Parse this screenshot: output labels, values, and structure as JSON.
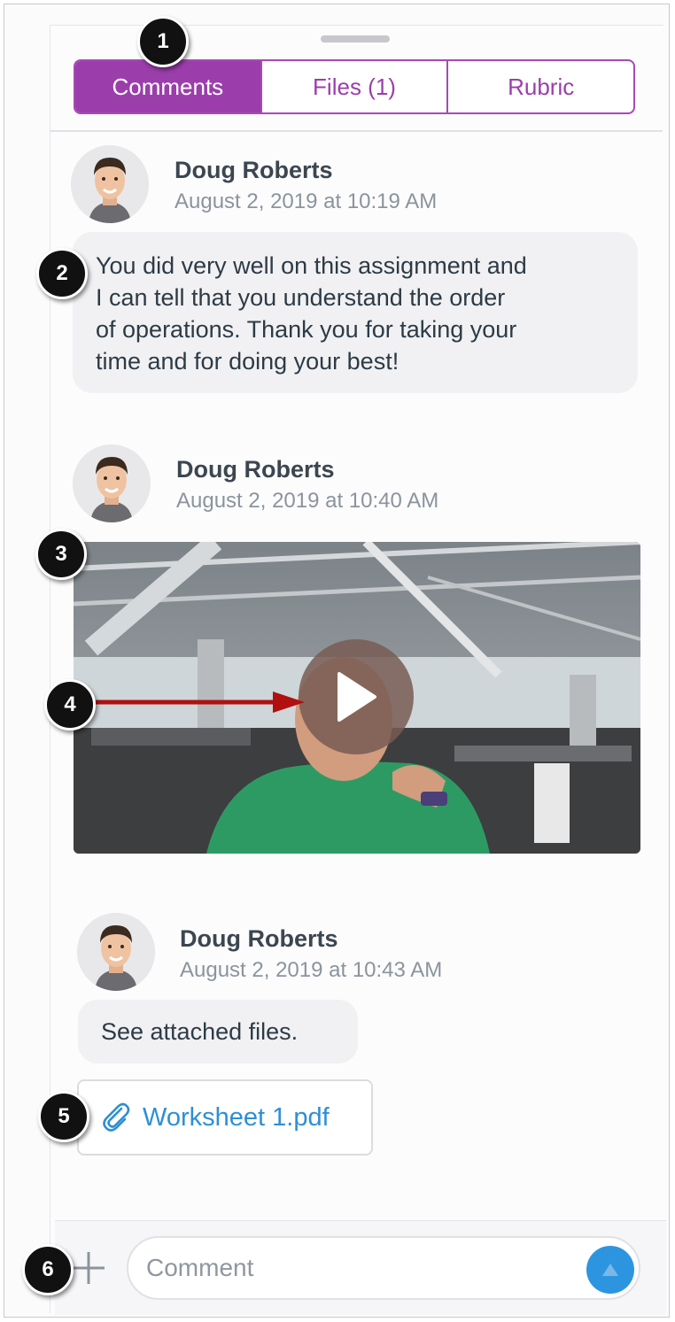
{
  "tabs": [
    {
      "label": "Comments",
      "active": true
    },
    {
      "label": "Files (1)",
      "active": false
    },
    {
      "label": "Rubric",
      "active": false
    }
  ],
  "comments": [
    {
      "author": "Doug Roberts",
      "timestamp": "August 2, 2019 at 10:19 AM",
      "text_lines": [
        "You did very well on this assignment and",
        "I can tell that you understand the order",
        "of operations. Thank you for taking your",
        "time and for doing your best!"
      ]
    },
    {
      "author": "Doug Roberts",
      "timestamp": "August 2, 2019 at 10:40 AM",
      "media": {
        "type": "video",
        "play_icon": "play-icon"
      }
    },
    {
      "author": "Doug Roberts",
      "timestamp": "August 2, 2019 at 10:43 AM",
      "text": "See attached files.",
      "attachment": {
        "name": "Worksheet 1.pdf",
        "icon": "paperclip-icon"
      }
    }
  ],
  "composer": {
    "placeholder": "Comment",
    "add_icon": "plus-icon",
    "send_icon": "send-arrow-icon"
  },
  "markers": [
    "1",
    "2",
    "3",
    "4",
    "5",
    "6"
  ],
  "colors": {
    "accent": "#9b3eab",
    "link": "#2d8fd6",
    "send": "#2d95e0",
    "arrow": "#b01010"
  }
}
